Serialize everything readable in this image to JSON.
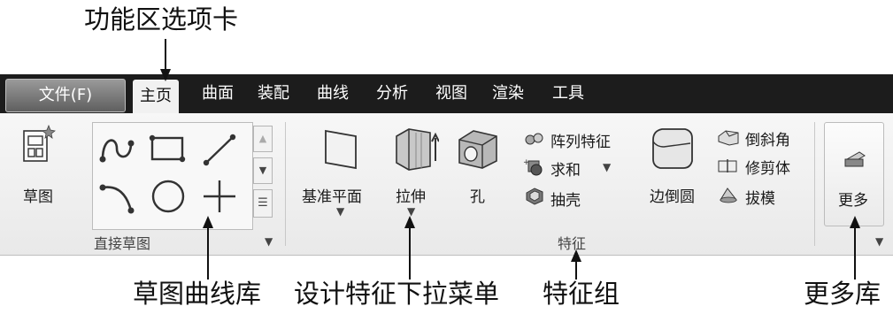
{
  "callouts": {
    "ribbon_tab": "功能区选项卡",
    "sketch_curve_library": "草图曲线库",
    "feature_dropdown": "设计特征下拉菜单",
    "feature_group": "特征组",
    "more_library": "更多库"
  },
  "tabs": {
    "file": "文件(F)",
    "home": "主页",
    "items": [
      "曲面",
      "装配",
      "曲线",
      "分析",
      "视图",
      "渲染",
      "工具"
    ]
  },
  "ribbon": {
    "sketch": "草图",
    "direct_sketch_group": "直接草图",
    "datum_plane": "基准平面",
    "extrude": "拉伸",
    "hole": "孔",
    "pattern_feature": "阵列特征",
    "unite": "求和",
    "shell": "抽壳",
    "edge_blend": "边倒圆",
    "chamfer": "倒斜角",
    "trim_body": "修剪体",
    "draft": "拔模",
    "feature_group": "特征",
    "more": "更多"
  }
}
